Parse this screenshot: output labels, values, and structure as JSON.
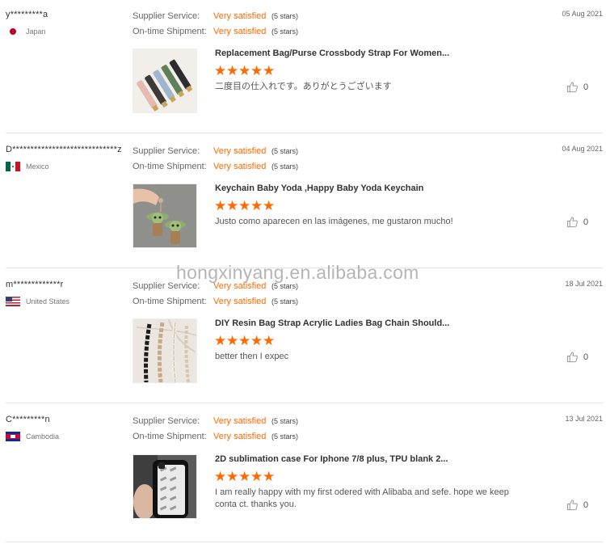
{
  "reviews": [
    {
      "buyer": "y*********a",
      "country": "Japan",
      "date": "05 Aug 2021",
      "supplier_service_label": "Supplier Service:",
      "supplier_service_value": "Very satisfied",
      "supplier_service_stars": "(5 stars)",
      "shipment_label": "On-time Shipment:",
      "shipment_value": "Very satisfied",
      "shipment_stars": "(5 stars)",
      "product": "Replacement Bag/Purse Crossbody Strap For Women...",
      "rating": 5,
      "text": "二度目の仕入れです。ありがとうございます",
      "likes": "0"
    },
    {
      "buyer": "D*****************************z",
      "country": "Mexico",
      "date": "04 Aug 2021",
      "supplier_service_label": "Supplier Service:",
      "supplier_service_value": "Very satisfied",
      "supplier_service_stars": "(5 stars)",
      "shipment_label": "On-time Shipment:",
      "shipment_value": "Very satisfied",
      "shipment_stars": "(5 stars)",
      "product": "Keychain Baby Yoda ,Happy Baby Yoda Keychain",
      "rating": 5,
      "text": "Justo como aparecen en las imágenes, me gustaron mucho!",
      "likes": "0"
    },
    {
      "buyer": "m*************r",
      "country": "United States",
      "date": "18 Jul 2021",
      "supplier_service_label": "Supplier Service:",
      "supplier_service_value": "Very satisfied",
      "supplier_service_stars": "(5 stars)",
      "shipment_label": "On-time Shipment:",
      "shipment_value": "Very satisfied",
      "shipment_stars": "(5 stars)",
      "product": "DIY Resin Bag Strap Acrylic Ladies Bag Chain Should...",
      "rating": 5,
      "text": "better then I expec",
      "likes": "0"
    },
    {
      "buyer": "C*********n",
      "country": "Cambodia",
      "date": "13 Jul 2021",
      "supplier_service_label": "Supplier Service:",
      "supplier_service_value": "Very satisfied",
      "supplier_service_stars": "(5 stars)",
      "shipment_label": "On-time Shipment:",
      "shipment_value": "Very satisfied",
      "shipment_stars": "(5 stars)",
      "product": "2D sublimation case For Iphone 7/8 plus, TPU blank 2...",
      "rating": 5,
      "text": "I am really happy with my first odered with Alibaba and sefe. hope we keep conta ct. thanks you.",
      "likes": "0"
    }
  ],
  "watermark": "hongxinyang.en.alibaba.com",
  "colors": {
    "accent": "#ff6a00",
    "divider": "#e3e3e3"
  },
  "icons": {
    "star": "star-icon",
    "like": "thumbs-up-icon"
  }
}
